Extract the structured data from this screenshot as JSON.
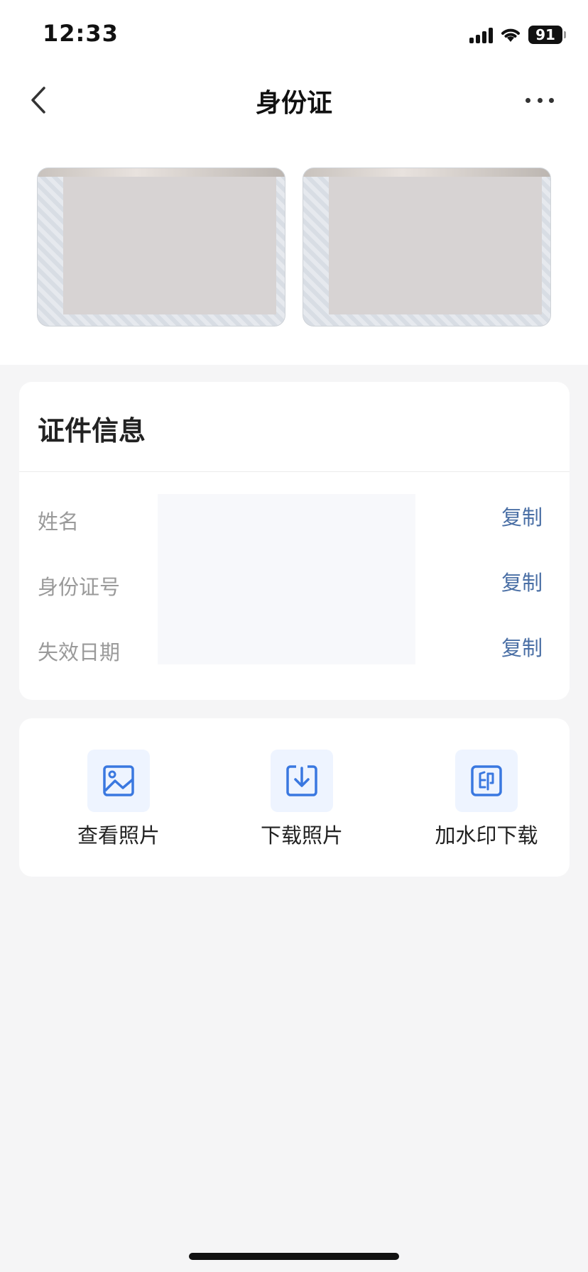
{
  "status_bar": {
    "time": "12:33",
    "battery": "91"
  },
  "nav": {
    "title": "身份证"
  },
  "info": {
    "title": "证件信息",
    "rows": [
      {
        "label": "姓名",
        "action": "复制"
      },
      {
        "label": "身份证号",
        "action": "复制"
      },
      {
        "label": "失效日期",
        "action": "复制"
      }
    ]
  },
  "actions": [
    {
      "label": "查看照片",
      "icon": "image-icon"
    },
    {
      "label": "下载照片",
      "icon": "download-icon"
    },
    {
      "label": "加水印下载",
      "icon": "watermark-icon"
    }
  ],
  "colors": {
    "accent": "#3a78e0",
    "copy": "#4a6fa5",
    "icon_bg": "#eef4ff"
  }
}
